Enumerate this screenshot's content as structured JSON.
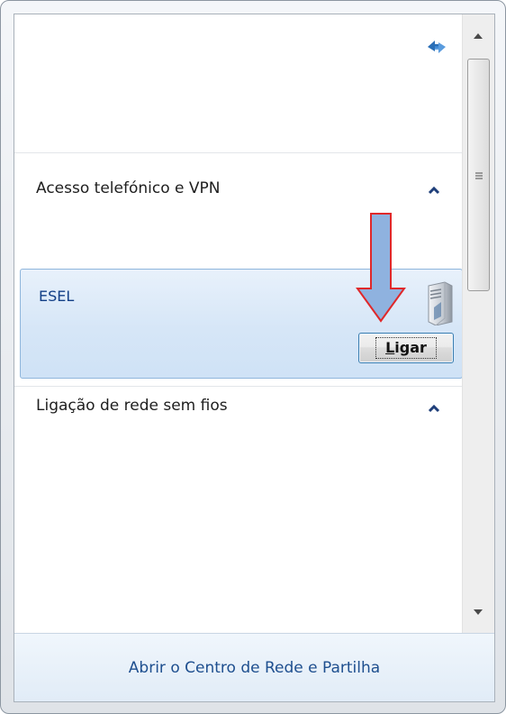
{
  "panel": {
    "refresh_icon": "refresh-arrows-icon",
    "sections": [
      {
        "label": "Acesso telefónico e VPN",
        "chevron": "chevron-up-icon"
      },
      {
        "label": "Ligação de rede sem fios",
        "chevron": "chevron-up-icon"
      }
    ],
    "connection": {
      "name": "ESEL",
      "icon": "vpn-server-icon",
      "button_label_underlined": "L",
      "button_label_rest": "igar"
    }
  },
  "footer": {
    "link_label": "Abrir o Centro de Rede e Partilha"
  },
  "annotation": {
    "arrow_icon": "annotation-down-arrow-icon"
  },
  "colors": {
    "link": "#1e4f8f",
    "connection_name": "#123f87",
    "annotation_fill": "#8fb2df",
    "annotation_stroke": "#e0282a"
  }
}
